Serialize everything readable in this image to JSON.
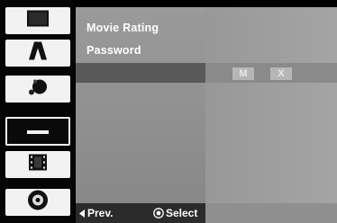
{
  "sidebar": {
    "items": [
      {
        "name": "sidebar-item-display",
        "icon": "display-icon",
        "active": false
      },
      {
        "name": "sidebar-item-language",
        "icon": "language-icon",
        "active": false
      },
      {
        "name": "sidebar-item-audio",
        "icon": "audio-icon",
        "active": false
      },
      {
        "name": "sidebar-item-lock",
        "icon": "lock-icon",
        "active": true
      },
      {
        "name": "sidebar-item-recording",
        "icon": "film-icon",
        "active": false
      },
      {
        "name": "sidebar-item-disc",
        "icon": "disc-icon",
        "active": false
      }
    ]
  },
  "menu": {
    "items": [
      {
        "label": "Movie Rating"
      },
      {
        "label": "Password"
      },
      {
        "label": ""
      }
    ]
  },
  "password_options": {
    "modify": "M",
    "delete": "X"
  },
  "footer": {
    "prev": "Prev.",
    "select": "Select"
  }
}
